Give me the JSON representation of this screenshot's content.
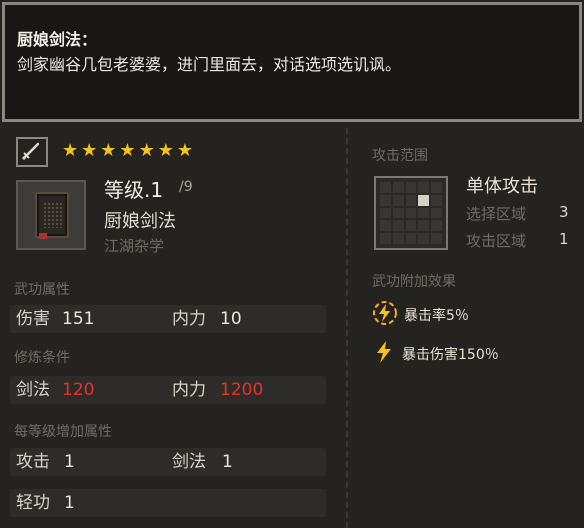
{
  "tooltip": {
    "title": "厨娘剑法：",
    "body": "剑家幽谷几包老婆婆，进门里面去，对话选项选讥讽。"
  },
  "skill": {
    "stars": [
      "★",
      "★",
      "★",
      "★",
      "★",
      "★",
      "★"
    ],
    "level": "等级.1",
    "level_max": "/9",
    "name": "厨娘剑法",
    "category": "江湖杂学",
    "weapon_icon": "sword-icon",
    "book_icon": "book-icon"
  },
  "attributes": {
    "header": "武功属性",
    "damage_label": "伤害",
    "damage_value": "151",
    "inner_label": "内力",
    "inner_value": "10"
  },
  "requirements": {
    "header": "修炼条件",
    "sword_label": "剑法",
    "sword_value": "120",
    "inner_label": "内力",
    "inner_value": "1200",
    "value_color": "#e5322c"
  },
  "per_level": {
    "header": "每等级增加属性",
    "attack_label": "攻击",
    "attack_value": "1",
    "sword_label": "剑法",
    "sword_value": "1",
    "agility_label": "轻功",
    "agility_value": "1"
  },
  "range": {
    "header": "攻击范围",
    "type": "单体攻击",
    "select_label": "选择区域",
    "select_value": "3",
    "attack_label": "攻击区域",
    "attack_value": "1"
  },
  "effects": {
    "header": "武功附加效果",
    "items": [
      {
        "icon": "lightning-circle-icon",
        "text": "暴击率5％"
      },
      {
        "icon": "lightning-icon",
        "text": "暴击伤害150％"
      }
    ]
  },
  "colors": {
    "star": "#f5c21a",
    "accent_red": "#e5322c"
  }
}
